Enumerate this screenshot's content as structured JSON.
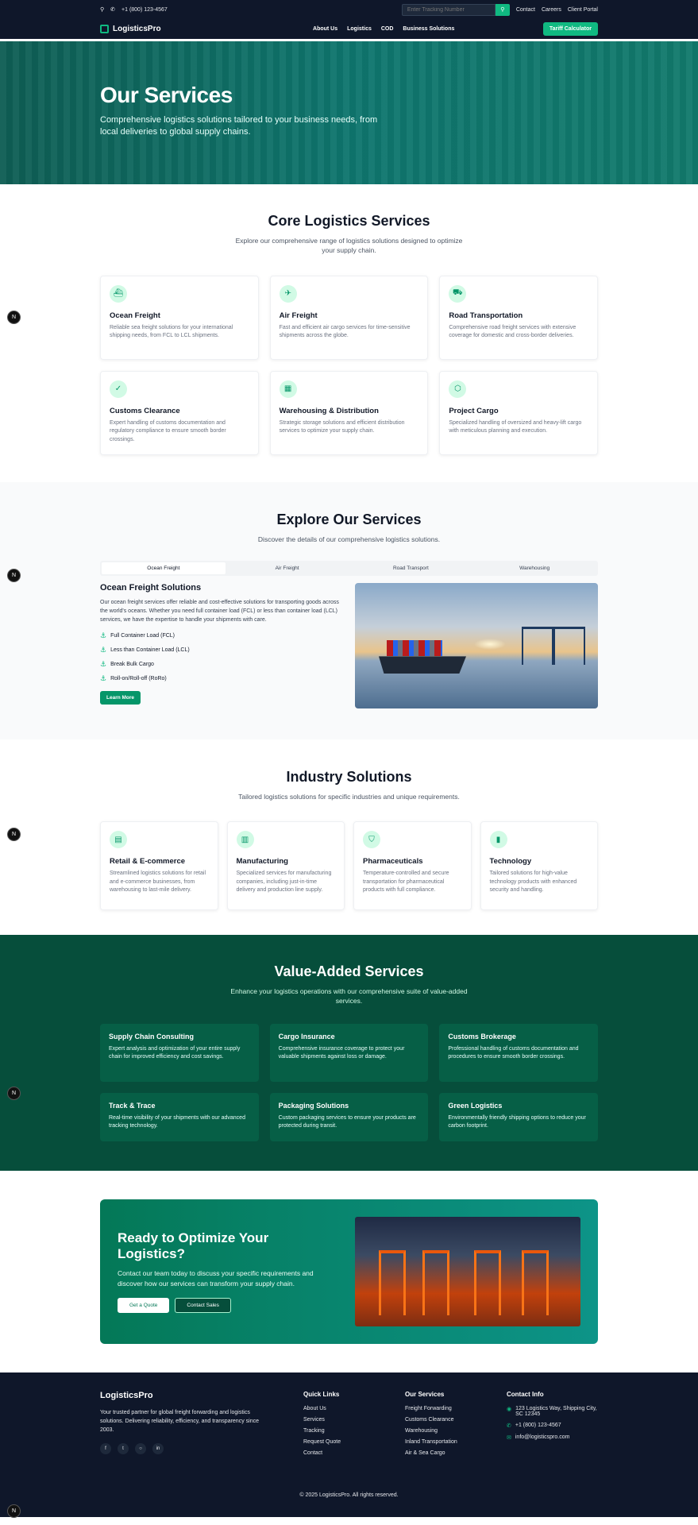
{
  "topbar": {
    "phone": "+1 (800) 123-4567",
    "tracking_placeholder": "Enter Tracking Number",
    "links": [
      "Contact",
      "Careers",
      "Client Portal"
    ]
  },
  "nav": {
    "brand": "LogisticsPro",
    "links": [
      "About Us",
      "Logistics",
      "COD",
      "Business Solutions"
    ],
    "cta": "Tariff Calculator"
  },
  "hero": {
    "title": "Our Services",
    "subtitle": "Comprehensive logistics solutions tailored to your business needs, from local deliveries to global supply chains."
  },
  "core": {
    "title": "Core Logistics Services",
    "subtitle": "Explore our comprehensive range of logistics solutions designed to optimize your supply chain.",
    "cards": [
      {
        "icon": "ship-icon",
        "glyph": "⛴",
        "title": "Ocean Freight",
        "text": "Reliable sea freight solutions for your international shipping needs, from FCL to LCL shipments."
      },
      {
        "icon": "plane-icon",
        "glyph": "✈",
        "title": "Air Freight",
        "text": "Fast and efficient air cargo services for time-sensitive shipments across the globe."
      },
      {
        "icon": "truck-icon",
        "glyph": "⛟",
        "title": "Road Transportation",
        "text": "Comprehensive road freight services with extensive coverage for domestic and cross-border deliveries."
      },
      {
        "icon": "document-check-icon",
        "glyph": "✓",
        "title": "Customs Clearance",
        "text": "Expert handling of customs documentation and regulatory compliance to ensure smooth border crossings."
      },
      {
        "icon": "warehouse-icon",
        "glyph": "▦",
        "title": "Warehousing & Distribution",
        "text": "Strategic storage solutions and efficient distribution services to optimize your supply chain."
      },
      {
        "icon": "package-icon",
        "glyph": "⬡",
        "title": "Project Cargo",
        "text": "Specialized handling of oversized and heavy-lift cargo with meticulous planning and execution."
      }
    ]
  },
  "explore": {
    "title": "Explore Our Services",
    "subtitle": "Discover the details of our comprehensive logistics solutions.",
    "tabs": [
      "Ocean Freight",
      "Air Freight",
      "Road Transport",
      "Warehousing"
    ],
    "active_tab": "Ocean Freight",
    "panel_title": "Ocean Freight Solutions",
    "panel_text": "Our ocean freight services offer reliable and cost-effective solutions for transporting goods across the world's oceans. Whether you need full container load (FCL) or less than container load (LCL) services, we have the expertise to handle your shipments with care.",
    "bullets": [
      "Full Container Load (FCL)",
      "Less than Container Load (LCL)",
      "Break Bulk Cargo",
      "Roll-on/Roll-off (RoRo)"
    ],
    "button": "Learn More"
  },
  "industry": {
    "title": "Industry Solutions",
    "subtitle": "Tailored logistics solutions for specific industries and unique requirements.",
    "cards": [
      {
        "icon": "store-icon",
        "glyph": "▤",
        "title": "Retail & E-commerce",
        "text": "Streamlined logistics solutions for retail and e-commerce businesses, from warehousing to last-mile delivery."
      },
      {
        "icon": "factory-icon",
        "glyph": "▥",
        "title": "Manufacturing",
        "text": "Specialized services for manufacturing companies, including just-in-time delivery and production line supply."
      },
      {
        "icon": "shield-icon",
        "glyph": "⛉",
        "title": "Pharmaceuticals",
        "text": "Temperature-controlled and secure transportation for pharmaceutical products with full compliance."
      },
      {
        "icon": "chart-icon",
        "glyph": "▮",
        "title": "Technology",
        "text": "Tailored solutions for high-value technology products with enhanced security and handling."
      }
    ]
  },
  "value": {
    "title": "Value-Added Services",
    "subtitle": "Enhance your logistics operations with our comprehensive suite of value-added services.",
    "cards": [
      {
        "title": "Supply Chain Consulting",
        "text": "Expert analysis and optimization of your entire supply chain for improved efficiency and cost savings."
      },
      {
        "title": "Cargo Insurance",
        "text": "Comprehensive insurance coverage to protect your valuable shipments against loss or damage."
      },
      {
        "title": "Customs Brokerage",
        "text": "Professional handling of customs documentation and procedures to ensure smooth border crossings."
      },
      {
        "title": "Track & Trace",
        "text": "Real-time visibility of your shipments with our advanced tracking technology."
      },
      {
        "title": "Packaging Solutions",
        "text": "Custom packaging services to ensure your products are protected during transit."
      },
      {
        "title": "Green Logistics",
        "text": "Environmentally friendly shipping options to reduce your carbon footprint."
      }
    ]
  },
  "cta": {
    "title": "Ready to Optimize Your Logistics?",
    "text": "Contact our team today to discuss your specific requirements and discover how our services can transform your supply chain.",
    "primary": "Get a Quote",
    "secondary": "Contact Sales"
  },
  "footer": {
    "brand": "LogisticsPro",
    "about": "Your trusted partner for global freight forwarding and logistics solutions. Delivering reliability, efficiency, and transparency since 2003.",
    "quick_links_title": "Quick Links",
    "quick_links": [
      "About Us",
      "Services",
      "Tracking",
      "Request Quote",
      "Contact"
    ],
    "services_title": "Our Services",
    "services": [
      "Freight Forwarding",
      "Customs Clearance",
      "Warehousing",
      "Inland Transportation",
      "Air & Sea Cargo"
    ],
    "contact_title": "Contact Info",
    "address": "123 Logistics Way, Shipping City, SC 12345",
    "phone": "+1 (800) 123-4567",
    "email": "info@logisticspro.com",
    "copyright": "© 2025 LogisticsPro. All rights reserved."
  },
  "dev_badge": "N",
  "colors": {
    "accent": "#10b981",
    "dark": "#0f172a",
    "deep_green": "#064e3b"
  }
}
